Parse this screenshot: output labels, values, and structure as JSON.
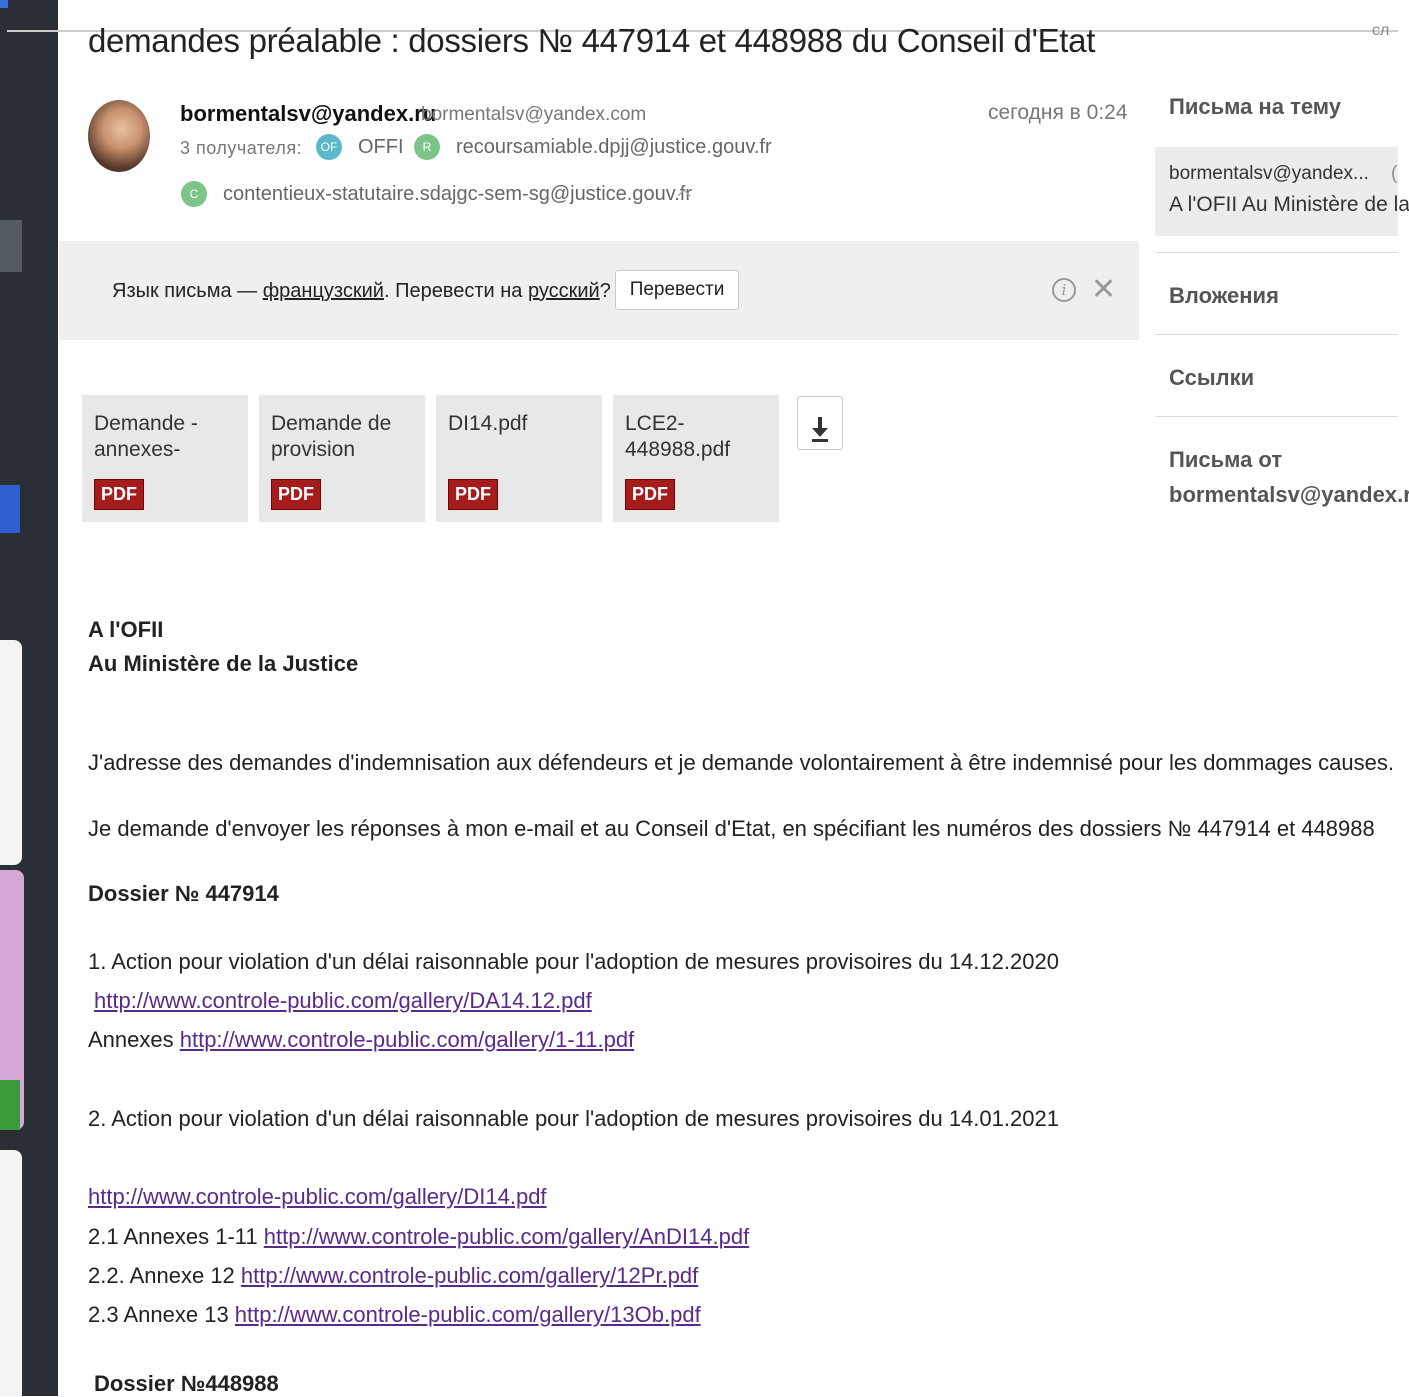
{
  "email": {
    "subject": "demandes préalable : dossiers № 447914 et 448988 du Conseil d'Etat",
    "subject_cut": "сл",
    "sender_name": "bormentalsv@yandex.ru",
    "sender_email": "bormentalsv@yandex.com",
    "date": "сегодня в 0:24",
    "recipients_label": "3 получателя:",
    "recipients": [
      {
        "initials": "OF",
        "name": "OFFI",
        "color": "#5bb8c7"
      },
      {
        "initials": "R",
        "name": "recoursamiable.dpjj@justice.gouv.fr",
        "color": "#7cc48a"
      },
      {
        "initials": "C",
        "name": "contentieux-statutaire.sdajgc-sem-sg@justice.gouv.fr",
        "color": "#7cc48a"
      }
    ],
    "collapse_icon": "chevron-up-icon"
  },
  "translate": {
    "prefix": "Язык письма — ",
    "lang_from": "французский",
    "middle": ". Перевести на ",
    "lang_to": "русский",
    "suffix": "?",
    "button": "Перевести",
    "info_icon": "info-icon",
    "close_icon": "close-icon"
  },
  "attachments": [
    {
      "name": "Demande - annexes-",
      "type": "PDF"
    },
    {
      "name": "Demande de provision",
      "type": "PDF"
    },
    {
      "name": "DI14.pdf",
      "type": "PDF"
    },
    {
      "name": "LCE2-448988.pdf",
      "type": "PDF"
    }
  ],
  "download_icon": "download-icon",
  "sidebar": {
    "thread_title": "Письма на тему",
    "thread_sender": "bormentalsv@yandex...",
    "thread_sender_cut": "(",
    "thread_preview": "A l'OFII Au Ministère de la .",
    "attachments": "Вложения",
    "links": "Ссылки",
    "from_label": "Письма от",
    "from_email": "bormentalsv@yandex.r"
  },
  "body": {
    "addr1": "A l'OFII",
    "addr2": "Au Ministère de la Justice",
    "p1": "J'adresse des demandes d'indemnisation aux défendeurs et je demande volontairement à être indemnisé pour les dommages causes.",
    "p2": "Je demande d'envoyer les réponses à mon e-mail et au Conseil d'Etat, en spécifiant les numéros des dossiers № 447914 et 448988",
    "dossier1": "Dossier № 447914",
    "item1": "1.    Action pour violation d'un délai raisonnable pour l'adoption de mesures provisoires du  14.12.2020",
    "link1": "http://www.controle-public.com/gallery/DA14.12.pdf",
    "annexes_label": "Annexes ",
    "link2": "http://www.controle-public.com/gallery/1-11.pdf",
    "item2": "2. Action pour violation d'un délai raisonnable pour l'adoption de mesures provisoires  du 14.01.2021",
    "link3": "http://www.controle-public.com/gallery/DI14.pdf",
    "sub21_label": "2.1    Annexes  1-11   ",
    "link4": "http://www.controle-public.com/gallery/AnDI14.pdf",
    "sub22_label": "2.2.    Annexe 12  ",
    "link5": "http://www.controle-public.com/gallery/12Pr.pdf",
    "sub23_label": "2.3   Annexe 13  ",
    "link6": "http://www.controle-public.com/gallery/13Ob.pdf",
    "dossier2": "Dossier №448988"
  }
}
